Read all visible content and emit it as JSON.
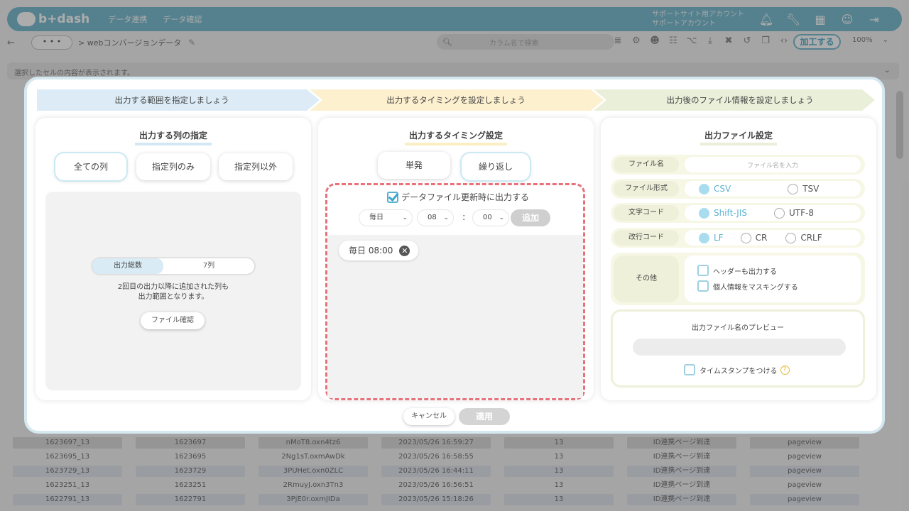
{
  "app": {
    "logo": "b+dash",
    "nav": [
      "データ連携",
      "データ確認"
    ],
    "account_line1": "サポートサイト用アカウント",
    "account_line2": "サポートアカウント"
  },
  "toolbar": {
    "back": "←",
    "more": "• • •",
    "breadcrumb": "> webコンバージョンデータ",
    "search_placeholder": "カラム名で検索",
    "process_button": "加工する",
    "zoom": "100%"
  },
  "infobar": {
    "text": "選択したセルの内容が表示されます。"
  },
  "grid": {
    "rows": [
      [
        "1623697_13",
        "1623697",
        "nMoT8.oxn4tz6",
        "2023/05/26 16:59:27",
        "13",
        "ID連携ページ到達",
        "pageview"
      ],
      [
        "1623695_13",
        "1623695",
        "2Ng1sT.oxmAwDk",
        "2023/05/26 16:58:55",
        "13",
        "ID連携ページ到達",
        "pageview"
      ],
      [
        "1623729_13",
        "1623729",
        "3PUHet.oxn0ZLC",
        "2023/05/26 16:44:11",
        "13",
        "ID連携ページ到達",
        "pageview"
      ],
      [
        "1623251_13",
        "1623251",
        "2RmuyJ.oxn3Tn3",
        "2023/05/26 16:56:51",
        "13",
        "ID連携ページ到達",
        "pageview"
      ],
      [
        "1622791_13",
        "1622791",
        "3PjE0r.oxmJIDa",
        "2023/05/26 15:18:26",
        "13",
        "ID連携ページ到達",
        "pageview"
      ]
    ]
  },
  "modal": {
    "steps": [
      "出力する範囲を指定しましょう",
      "出力するタイミングを設定しましょう",
      "出力後のファイル情報を設定しましょう"
    ],
    "columns_panel": {
      "title": "出力する列の指定",
      "options": [
        "全ての列",
        "指定列のみ",
        "指定列以外"
      ],
      "total_label": "出力総数",
      "total_value": "7列",
      "note_line1": "2回目の出力以降に追加された列も",
      "note_line2": "出力範囲となります。",
      "file_check": "ファイル確認"
    },
    "timing_panel": {
      "title": "出力するタイミング設定",
      "options": [
        "単発",
        "繰り返し"
      ],
      "on_update_label": "データファイル更新時に出力する",
      "freq": "毎日",
      "hour": "08",
      "minute": "00",
      "colon": ":",
      "add": "追加",
      "schedule_item": "毎日 08:00"
    },
    "file_panel": {
      "title": "出力ファイル設定",
      "filename_label": "ファイル名",
      "filename_placeholder": "ファイル名を入力",
      "format_label": "ファイル形式",
      "formats": [
        "CSV",
        "TSV"
      ],
      "encoding_label": "文字コード",
      "encodings": [
        "Shift-JIS",
        "UTF-8"
      ],
      "newline_label": "改行コード",
      "newlines": [
        "LF",
        "CR",
        "CRLF"
      ],
      "other_label": "その他",
      "other_options": [
        "ヘッダーも出力する",
        "個人情報をマスキングする"
      ],
      "preview_title": "出力ファイル名のプレビュー",
      "timestamp_label": "タイムスタンプをつける"
    },
    "cancel": "キャンセル",
    "apply": "適用"
  },
  "colors": {
    "accent": "#61b1c9",
    "dash": "#e6737b",
    "step1": "#dcebf6",
    "step2": "#fcf0cf",
    "step3": "#eaefda"
  }
}
